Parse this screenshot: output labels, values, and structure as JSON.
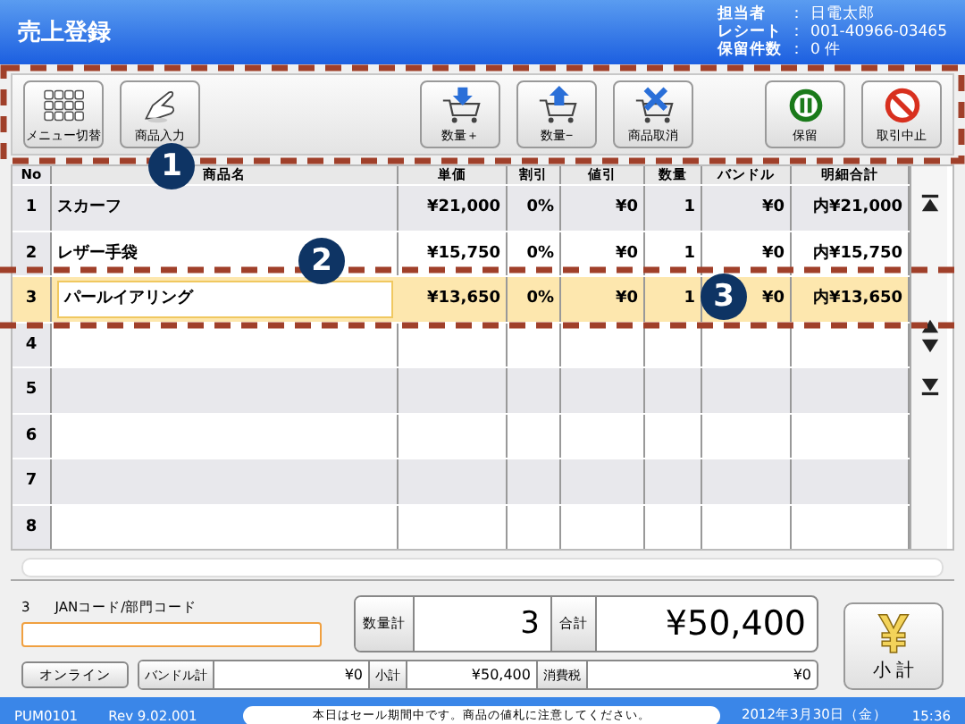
{
  "header": {
    "title": "売上登録",
    "info": [
      {
        "label": "担当者",
        "sep": "：",
        "value": "日電太郎"
      },
      {
        "label": "レシート",
        "sep": "：",
        "value": "001-40966-03465"
      },
      {
        "label": "保留件数",
        "sep": "：",
        "value": "0 件"
      }
    ]
  },
  "toolbar": {
    "groups": [
      [
        {
          "kind": "menu",
          "label": "メニュー切替"
        },
        {
          "kind": "hand",
          "label": "商品入力"
        }
      ],
      [
        {
          "kind": "qty_plus",
          "label": "数量＋"
        },
        {
          "kind": "qty_minus",
          "label": "数量−"
        },
        {
          "kind": "cancel_item",
          "label": "商品取消"
        }
      ],
      [
        {
          "kind": "hold",
          "label": "保留"
        },
        {
          "kind": "stop",
          "label": "取引中止"
        }
      ]
    ]
  },
  "table": {
    "columns": [
      "No",
      "商品名",
      "単価",
      "割引",
      "値引",
      "数量",
      "バンドル",
      "明細合計"
    ],
    "rows": [
      {
        "cells": [
          "1",
          "スカーフ",
          "¥21,000",
          "0%",
          "¥0",
          "1",
          "¥0",
          "内¥21,000"
        ],
        "selected": false
      },
      {
        "cells": [
          "2",
          "レザー手袋",
          "¥15,750",
          "0%",
          "¥0",
          "1",
          "¥0",
          "内¥15,750"
        ],
        "selected": false
      },
      {
        "cells": [
          "3",
          "パールイアリング",
          "¥13,650",
          "0%",
          "¥0",
          "1",
          "¥0",
          "内¥13,650"
        ],
        "selected": true
      },
      {
        "cells": [
          "4"
        ],
        "selected": false
      },
      {
        "cells": [
          "5"
        ],
        "selected": false
      },
      {
        "cells": [
          "6"
        ],
        "selected": false
      },
      {
        "cells": [
          "7"
        ],
        "selected": false
      },
      {
        "cells": [
          "8"
        ],
        "selected": false
      }
    ]
  },
  "entry": {
    "count": "3",
    "label": "JANコード/部門コード",
    "online": "オンライン"
  },
  "totals": {
    "qty_label": "数量計",
    "qty": "3",
    "total_label": "合計",
    "total": "¥50,400",
    "bundle_label": "バンドル計",
    "bundle": "¥0",
    "subtotal_label": "小計",
    "subtotal": "¥50,400",
    "tax_label": "消費税",
    "tax": "¥0"
  },
  "subtotal_button": {
    "label": "小 計"
  },
  "status": {
    "code": "PUM0101",
    "rev": "Rev 9.02.001",
    "message": "本日はセール期間中です。商品の値札に注意してください。",
    "date": "2012年3月30日（金）",
    "time": "15:36"
  },
  "callouts": [
    "1",
    "2",
    "3"
  ]
}
